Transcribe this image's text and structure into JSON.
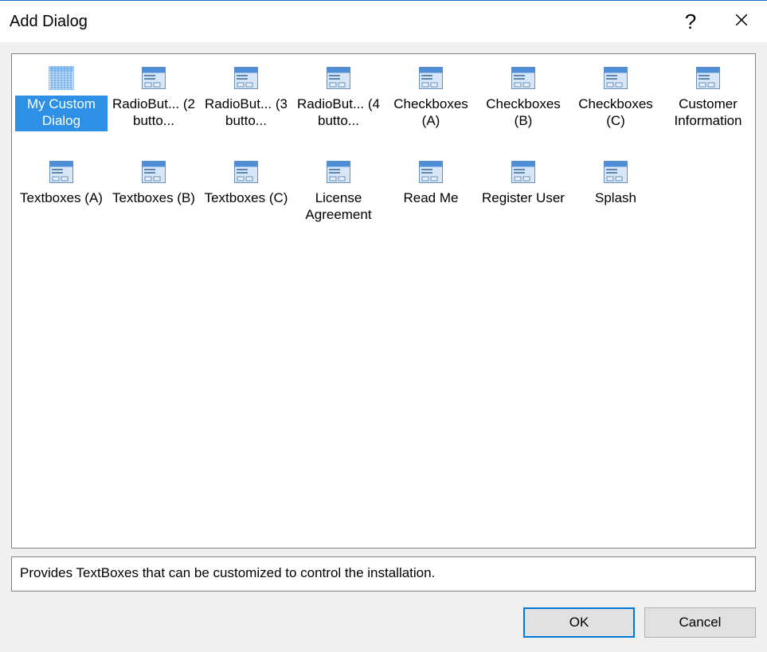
{
  "title": "Add Dialog",
  "items": [
    {
      "label": "My Custom Dialog",
      "selected": true,
      "iconSpecial": true
    },
    {
      "label": "RadioBut... (2 butto..."
    },
    {
      "label": "RadioBut... (3 butto..."
    },
    {
      "label": "RadioBut... (4 butto..."
    },
    {
      "label": "Checkboxes (A)"
    },
    {
      "label": "Checkboxes (B)"
    },
    {
      "label": "Checkboxes (C)"
    },
    {
      "label": "Customer Information"
    },
    {
      "label": "Textboxes (A)"
    },
    {
      "label": "Textboxes (B)"
    },
    {
      "label": "Textboxes (C)"
    },
    {
      "label": "License Agreement"
    },
    {
      "label": "Read Me"
    },
    {
      "label": "Register User"
    },
    {
      "label": "Splash"
    }
  ],
  "description": "Provides TextBoxes that can be customized to control the installation.",
  "buttons": {
    "ok": "OK",
    "cancel": "Cancel"
  }
}
